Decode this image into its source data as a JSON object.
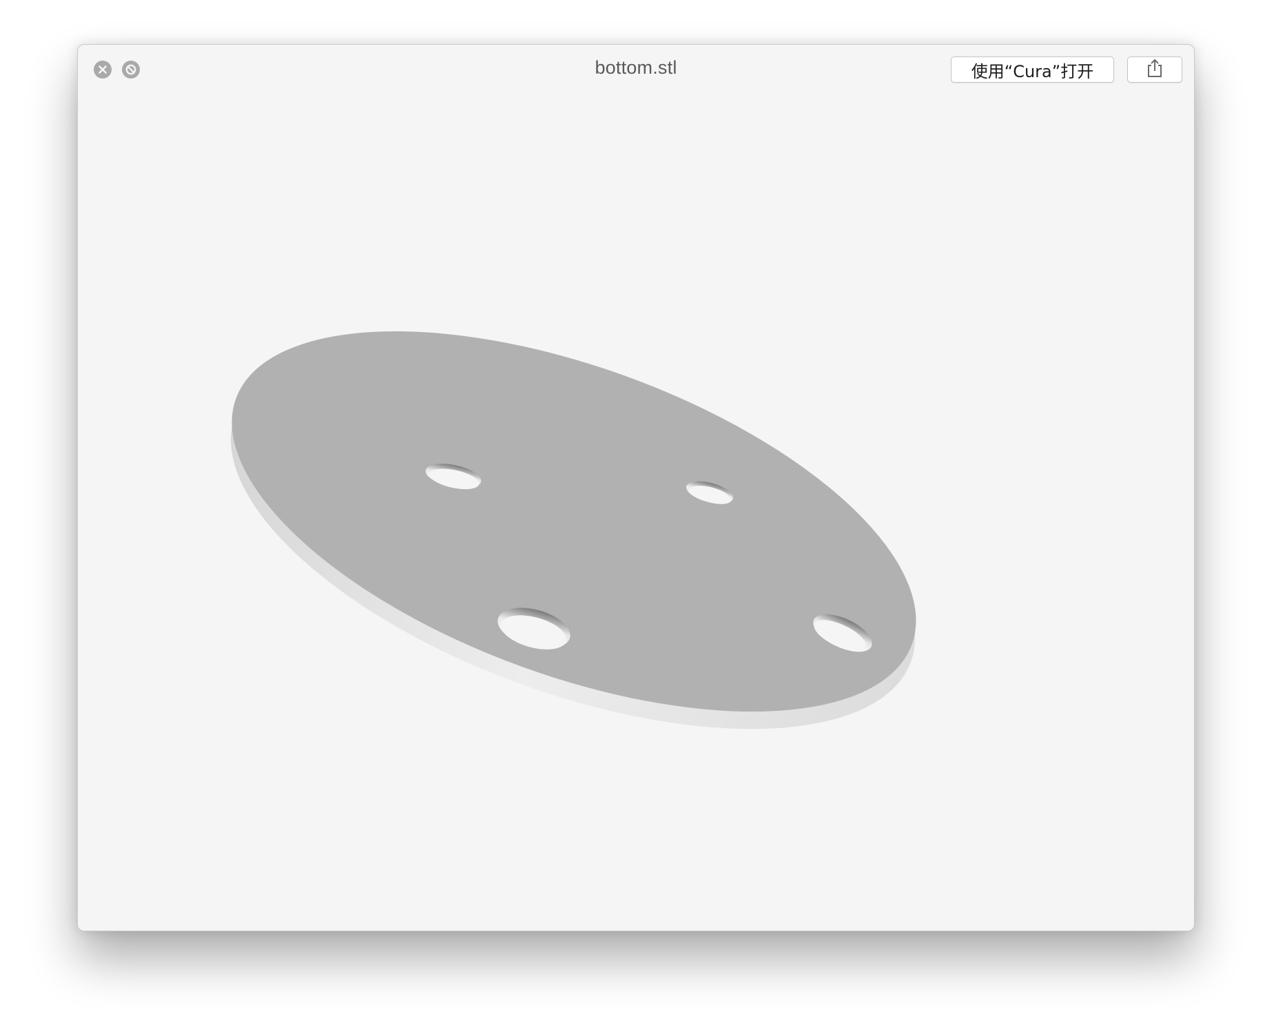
{
  "window": {
    "title": "bottom.stl",
    "controls": {
      "close_icon": "close-icon",
      "fullscreen_icon": "fullscreen-icon"
    }
  },
  "toolbar": {
    "open_with_label": "使用“Cura”打开",
    "share_icon": "share-icon"
  },
  "preview": {
    "model": "3d-disc-with-four-holes",
    "plate_color": "#b1b1b1",
    "edge_color": "#e6e6e6",
    "background_color": "#f5f5f5"
  }
}
